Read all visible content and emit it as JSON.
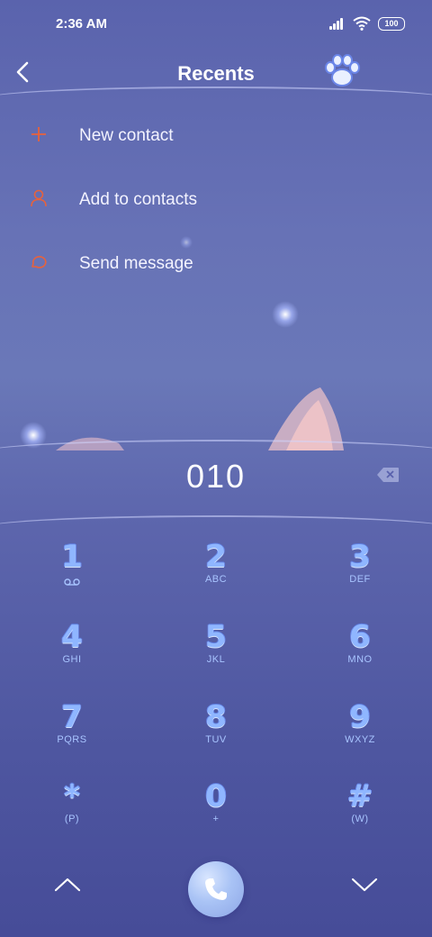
{
  "status_bar": {
    "time": "2:36 AM",
    "battery": "100"
  },
  "header": {
    "title": "Recents",
    "back_icon": "chevron-left-icon",
    "theme_icon": "paw-icon"
  },
  "menu": [
    {
      "label": "New contact",
      "icon": "plus-icon"
    },
    {
      "label": "Add to contacts",
      "icon": "person-icon"
    },
    {
      "label": "Send message",
      "icon": "message-bubble-icon"
    }
  ],
  "accent_color": "#e8623b",
  "dialer": {
    "number": "010"
  },
  "keypad": [
    {
      "digit": "1",
      "letters": ""
    },
    {
      "digit": "2",
      "letters": "ABC"
    },
    {
      "digit": "3",
      "letters": "DEF"
    },
    {
      "digit": "4",
      "letters": "GHI"
    },
    {
      "digit": "5",
      "letters": "JKL"
    },
    {
      "digit": "6",
      "letters": "MNO"
    },
    {
      "digit": "7",
      "letters": "PQRS"
    },
    {
      "digit": "8",
      "letters": "TUV"
    },
    {
      "digit": "9",
      "letters": "WXYZ"
    },
    {
      "digit": "*",
      "letters": "(P)"
    },
    {
      "digit": "0",
      "letters": "+"
    },
    {
      "digit": "#",
      "letters": "(W)"
    }
  ]
}
